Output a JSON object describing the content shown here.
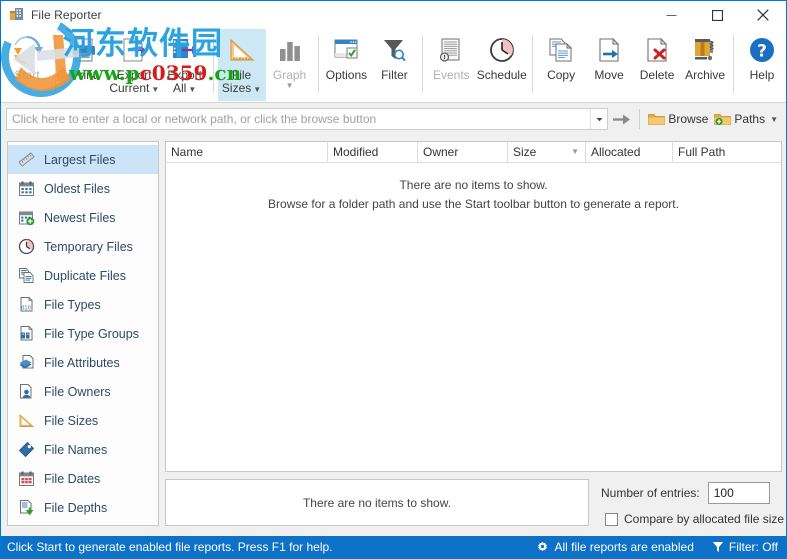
{
  "window": {
    "title": "File Reporter",
    "icon": "app-building-icon",
    "minimize": "–",
    "maximize": "□",
    "close": "✕"
  },
  "toolbar": {
    "items": [
      {
        "id": "start",
        "label": "Start",
        "label2": "",
        "icon": "refresh-arrows-icon",
        "disabled": true,
        "selected": false,
        "dropdown": false
      },
      {
        "id": "print",
        "label": "Print",
        "label2": "",
        "icon": "printer-icon",
        "disabled": false,
        "selected": false,
        "dropdown": false
      },
      {
        "id": "export-current",
        "label": "Export",
        "label2": "Current",
        "icon": "export-page-icon",
        "disabled": false,
        "selected": false,
        "dropdown": true
      },
      {
        "id": "export-all",
        "label": "Export",
        "label2": "All",
        "icon": "export-all-icon",
        "disabled": false,
        "selected": false,
        "dropdown": true
      },
      {
        "id": "file-sizes",
        "label": "File",
        "label2": "Sizes",
        "icon": "ruler-icon",
        "disabled": false,
        "selected": true,
        "dropdown": true
      },
      {
        "id": "graph",
        "label": "Graph",
        "label2": "",
        "icon": "bar-chart-icon",
        "disabled": true,
        "selected": false,
        "dropdown": true
      },
      {
        "id": "options",
        "label": "Options",
        "label2": "",
        "icon": "window-check-icon",
        "disabled": false,
        "selected": false,
        "dropdown": false
      },
      {
        "id": "filter",
        "label": "Filter",
        "label2": "",
        "icon": "funnel-search-icon",
        "disabled": false,
        "selected": false,
        "dropdown": false
      },
      {
        "id": "events",
        "label": "Events",
        "label2": "",
        "icon": "document-alert-icon",
        "disabled": true,
        "selected": false,
        "dropdown": false
      },
      {
        "id": "schedule",
        "label": "Schedule",
        "label2": "",
        "icon": "clock-icon",
        "disabled": false,
        "selected": false,
        "dropdown": false
      },
      {
        "id": "copy",
        "label": "Copy",
        "label2": "",
        "icon": "copy-pages-icon",
        "disabled": false,
        "selected": false,
        "dropdown": false
      },
      {
        "id": "move",
        "label": "Move",
        "label2": "",
        "icon": "page-arrow-icon",
        "disabled": false,
        "selected": false,
        "dropdown": false
      },
      {
        "id": "delete",
        "label": "Delete",
        "label2": "",
        "icon": "page-x-icon",
        "disabled": false,
        "selected": false,
        "dropdown": false
      },
      {
        "id": "archive",
        "label": "Archive",
        "label2": "",
        "icon": "archive-box-icon",
        "disabled": false,
        "selected": false,
        "dropdown": false
      },
      {
        "id": "help",
        "label": "Help",
        "label2": "",
        "icon": "help-circle-icon",
        "disabled": false,
        "selected": false,
        "dropdown": false
      }
    ],
    "separators_after": [
      "start",
      "export-all",
      "graph",
      "filter",
      "schedule",
      "archive"
    ]
  },
  "pathbar": {
    "placeholder": "Click here to enter a local or network path, or click the browse button",
    "value": "",
    "go_icon": "go-arrow-icon",
    "browse_label": "Browse",
    "browse_icon": "folder-icon",
    "paths_label": "Paths",
    "paths_icon": "folder-plus-icon"
  },
  "sidebar": {
    "items": [
      {
        "label": "Largest Files",
        "icon": "ruler-diagonal-icon",
        "selected": true
      },
      {
        "label": "Oldest Files",
        "icon": "calendar-icon",
        "selected": false
      },
      {
        "label": "Newest Files",
        "icon": "calendar-plus-icon",
        "selected": false
      },
      {
        "label": "Temporary Files",
        "icon": "clock-pie-icon",
        "selected": false
      },
      {
        "label": "Duplicate Files",
        "icon": "duplicate-pages-icon",
        "selected": false
      },
      {
        "label": "File Types",
        "icon": "page-010-icon",
        "selected": false
      },
      {
        "label": "File Type Groups",
        "icon": "page-groups-icon",
        "selected": false
      },
      {
        "label": "File Attributes",
        "icon": "page-stack-icon",
        "selected": false
      },
      {
        "label": "File Owners",
        "icon": "page-user-icon",
        "selected": false
      },
      {
        "label": "File Sizes",
        "icon": "ruler-triangle-icon",
        "selected": false
      },
      {
        "label": "File Names",
        "icon": "tag-icon",
        "selected": false
      },
      {
        "label": "File Dates",
        "icon": "calendar-red-icon",
        "selected": false
      },
      {
        "label": "File Depths",
        "icon": "page-down-arrow-icon",
        "selected": false
      }
    ]
  },
  "listview": {
    "columns": [
      {
        "label": "Name",
        "width": 162,
        "sorted": false
      },
      {
        "label": "Modified",
        "width": 90,
        "sorted": false
      },
      {
        "label": "Owner",
        "width": 90,
        "sorted": false
      },
      {
        "label": "Size",
        "width": 78,
        "sorted": true
      },
      {
        "label": "Allocated",
        "width": 87,
        "sorted": false
      },
      {
        "label": "Full Path",
        "width": 108,
        "sorted": false
      }
    ],
    "empty_line1": "There are no items to show.",
    "empty_line2": "Browse for a folder path and use the Start toolbar button to generate a report."
  },
  "summary": {
    "empty_text": "There are no items to show."
  },
  "options": {
    "entries_label": "Number of entries:",
    "entries_value": "100",
    "compare_label": "Compare by allocated file size",
    "compare_checked": false
  },
  "statusbar": {
    "message": "Click Start to generate enabled file reports. Press F1 for help.",
    "reports_status": "All file reports are enabled",
    "reports_icon": "gear-icon",
    "filter_status": "Filter: Off",
    "filter_icon": "funnel-icon"
  },
  "watermark": {
    "chinese": "河东软件园",
    "url_green1": "www.p",
    "url_red": "c0359",
    "url_green2": ".cn"
  },
  "colors": {
    "accent": "#0e71c8",
    "selection": "#cce4f7",
    "toolbar_selection": "#cce8f4",
    "text": "#2e4a66"
  }
}
